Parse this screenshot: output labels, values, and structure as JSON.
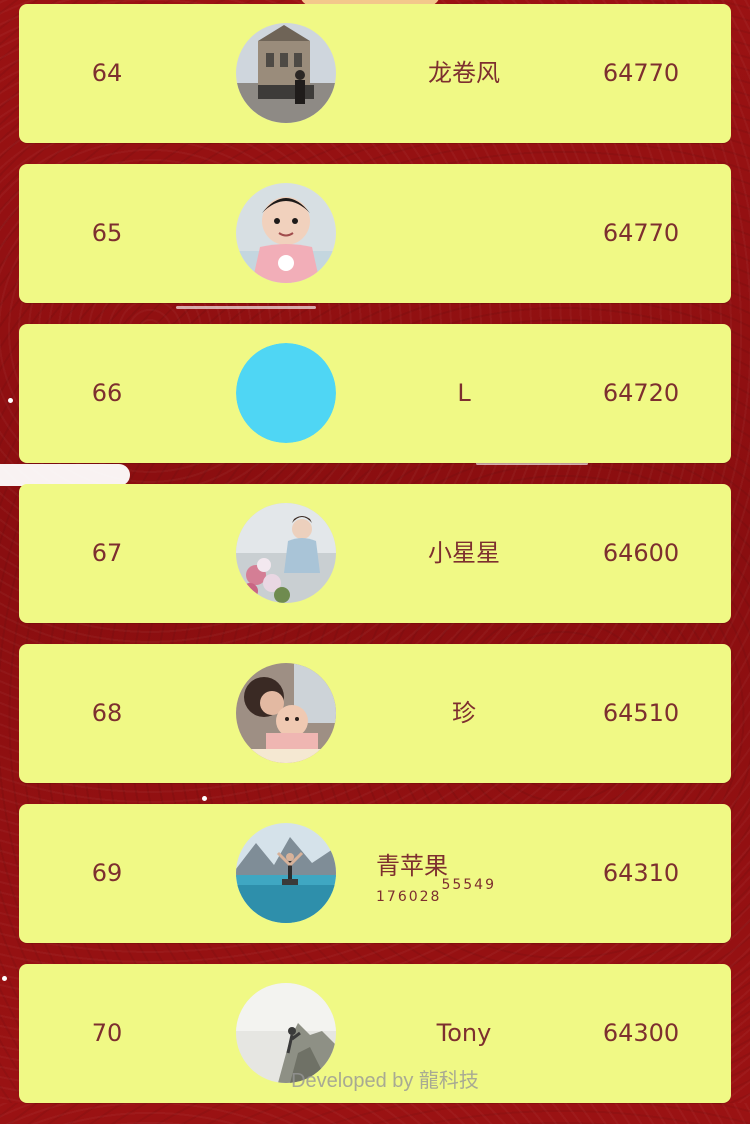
{
  "ranking": {
    "rows": [
      {
        "rank": "64",
        "name": "龙卷风",
        "score": "64770",
        "avatar": "building-photo-avatar"
      },
      {
        "rank": "65",
        "name": "",
        "score": "64770",
        "avatar": "baby-photo-avatar"
      },
      {
        "rank": "66",
        "name": "L",
        "score": "64720",
        "avatar": "solid-color-avatar",
        "avatar_color": "#4fd6f4"
      },
      {
        "rank": "67",
        "name": "小星星",
        "score": "64600",
        "avatar": "flowers-photo-avatar"
      },
      {
        "rank": "68",
        "name": "珍",
        "score": "64510",
        "avatar": "mother-baby-photo-avatar"
      },
      {
        "rank": "69",
        "name": "青苹果",
        "name_sub": "176028",
        "name_sup": "55549",
        "score": "64310",
        "avatar": "lake-photo-avatar"
      },
      {
        "rank": "70",
        "name": "Tony",
        "score": "64300",
        "avatar": "mountain-photo-avatar"
      }
    ]
  },
  "footer": {
    "credit": "Developed by 龍科技"
  },
  "colors": {
    "background": "#8f0f10",
    "card": "#f0f985",
    "text": "#7d2f2f"
  }
}
